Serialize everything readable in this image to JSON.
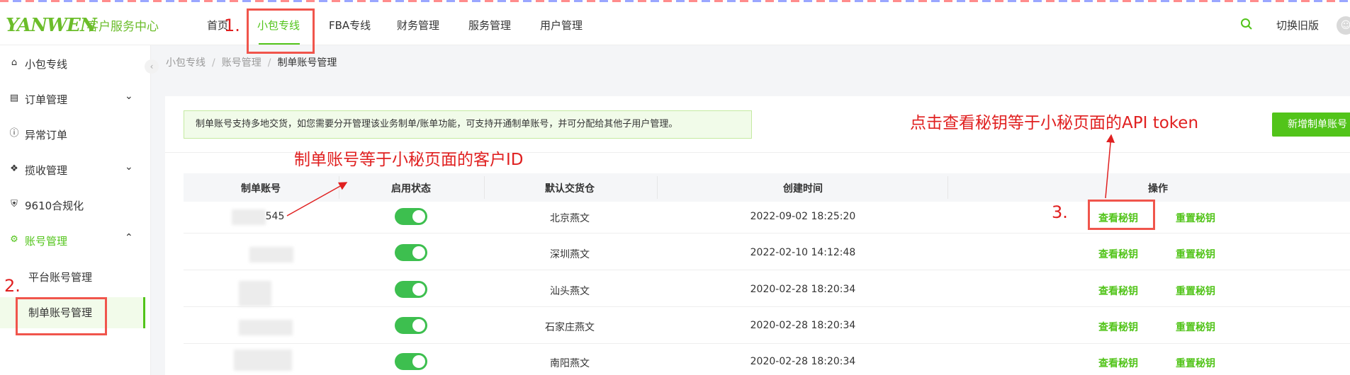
{
  "header": {
    "logo": "YANWEN",
    "logo_sub": "客户服务中心",
    "nav": [
      "首页",
      "小包专线",
      "FBA专线",
      "财务管理",
      "服务管理",
      "用户管理"
    ],
    "switch_old": "切换旧版",
    "avatar_icon": "user-icon"
  },
  "sidebar": {
    "items": [
      {
        "label": "小包专线",
        "icon": "home-icon"
      },
      {
        "label": "订单管理",
        "icon": "order-icon"
      },
      {
        "label": "异常订单",
        "icon": "alert-icon"
      },
      {
        "label": "揽收管理",
        "icon": "box-icon"
      },
      {
        "label": "9610合规化",
        "icon": "shield-icon"
      },
      {
        "label": "账号管理",
        "icon": "gear-icon"
      }
    ],
    "sub_items": [
      "平台账号管理",
      "制单账号管理"
    ]
  },
  "breadcrumb": {
    "items": [
      "小包专线",
      "账号管理",
      "制单账号管理"
    ]
  },
  "notice": "制单账号支持多地交货，如您需要分开管理该业务制单/账单功能，可支持开通制单账号，并可分配给其他子用户管理。",
  "add_button": "新增制单账号",
  "table": {
    "headers": [
      "制单账号",
      "启用状态",
      "默认交货仓",
      "创建时间",
      "操作"
    ],
    "rows": [
      {
        "account": "545",
        "warehouse": "北京燕文",
        "created": "2022-09-02 18:25:20",
        "enabled": true
      },
      {
        "account": "",
        "warehouse": "深圳燕文",
        "created": "2022-02-10 14:12:48",
        "enabled": true
      },
      {
        "account": "",
        "warehouse": "汕头燕文",
        "created": "2020-02-28 18:20:34",
        "enabled": true
      },
      {
        "account": "",
        "warehouse": "石家庄燕文",
        "created": "2020-02-28 18:20:34",
        "enabled": true
      },
      {
        "account": "",
        "warehouse": "南阳燕文",
        "created": "2020-02-28 18:20:34",
        "enabled": true
      }
    ],
    "action_view": "查看秘钥",
    "action_reset": "重置秘钥"
  },
  "annotations": {
    "step1": "1.",
    "step2": "2.",
    "step3": "3.",
    "customer_id_note": "制单账号等于小秘页面的客户ID",
    "token_note": "点击查看秘钥等于小秘页面的API token"
  },
  "colors": {
    "accent": "#52c41a",
    "annotation": "#e02020"
  }
}
